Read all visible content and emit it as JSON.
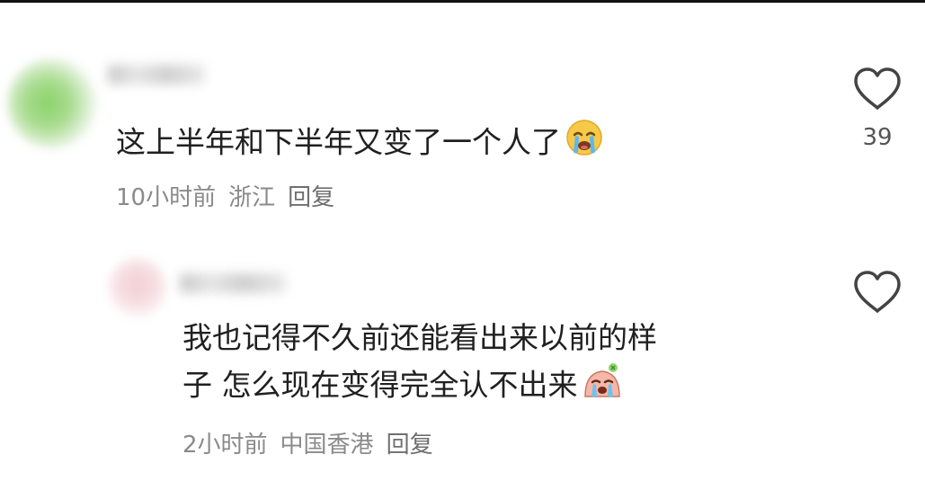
{
  "comments": [
    {
      "text": "这上半年和下半年又变了一个人了",
      "emoji": "loudly-crying-face-icon",
      "time": "10小时前",
      "location": "浙江",
      "reply_label": "回复",
      "likes": "39"
    },
    {
      "text_line1": "我也记得不久前还能看出来以前的样",
      "text_line2": "子 怎么现在变得完全认不出来",
      "emoji": "crying-character-icon",
      "time": "2小时前",
      "location": "中国香港",
      "reply_label": "回复",
      "likes": ""
    }
  ],
  "colors": {
    "text": "#202020",
    "meta": "#8a8a8a",
    "icon": "#444444"
  }
}
